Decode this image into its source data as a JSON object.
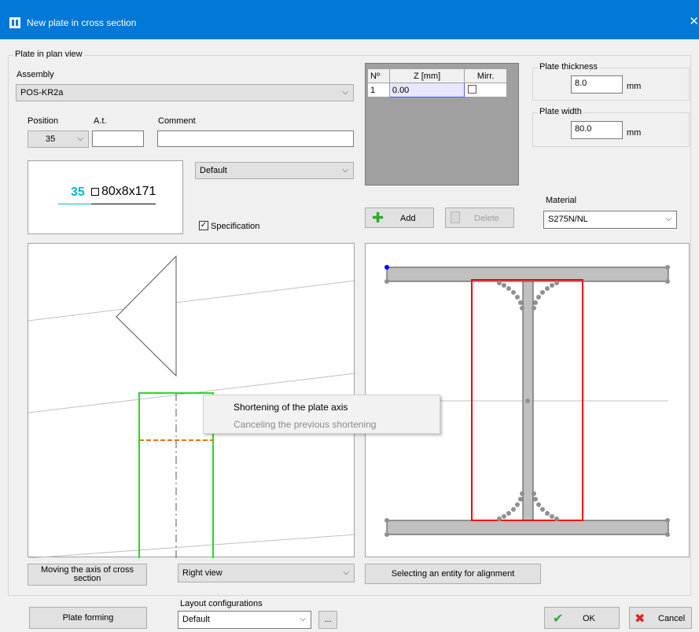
{
  "window": {
    "title": "New plate in cross section",
    "close_glyph": "✕"
  },
  "plate_in_plan_view": {
    "legend": "Plate in plan view",
    "assembly_label": "Assembly",
    "assembly_value": "POS-KR2a",
    "position_label": "Position",
    "position_value": "35",
    "at_label": "A.t.",
    "at_value": "",
    "comment_label": "Comment",
    "comment_value": "",
    "preview_number": "35",
    "preview_profile": "80x8x171",
    "style_value": "Default",
    "specification_label": "Specification",
    "specification_checked": true
  },
  "z_table": {
    "headers": [
      "Nº",
      "Z [mm]",
      "Mirr."
    ],
    "rows": [
      {
        "no": "1",
        "z": "0.00",
        "mirrored": false
      }
    ]
  },
  "buttons": {
    "add": "Add",
    "delete": "Delete",
    "moving_axis": "Moving the axis of cross section",
    "selecting_entity": "Selecting an entity for alignment",
    "plate_forming": "Plate forming",
    "ellipsis": "...",
    "ok": "OK",
    "cancel": "Cancel"
  },
  "plate_thickness": {
    "legend": "Plate thickness",
    "value": "8.0",
    "unit": "mm"
  },
  "plate_width": {
    "legend": "Plate width",
    "value": "80.0",
    "unit": "mm"
  },
  "material": {
    "label": "Material",
    "value": "S275N/NL"
  },
  "view": {
    "value": "Right view"
  },
  "layout_configurations": {
    "label": "Layout configurations",
    "value": "Default"
  },
  "context_menu": {
    "items": [
      {
        "label": "Shortening of the plate axis",
        "enabled": true
      },
      {
        "label": "Canceling the previous shortening",
        "enabled": false
      }
    ]
  },
  "icons": {
    "add": "plus-icon",
    "delete": "trash-icon",
    "ok": "checkmark-icon",
    "cancel": "red-x-icon"
  },
  "colors": {
    "titlebar": "#0078d7",
    "plate_outline": "#22dd22",
    "shortening_line": "#e07800",
    "highlight_rect": "#ff0000",
    "preview_number": "#00bcd4",
    "selected_cell_bg": "#e6e6ff"
  }
}
